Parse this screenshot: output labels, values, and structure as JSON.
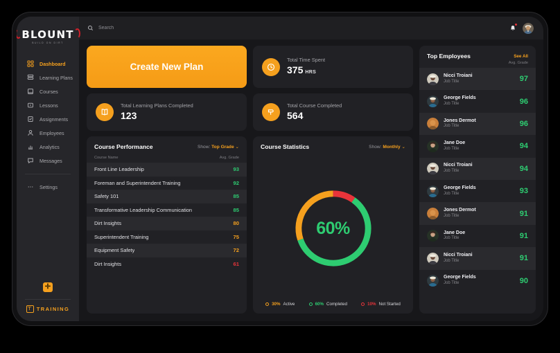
{
  "brand": {
    "logo_text": "BLOUNT",
    "logo_tagline": "BUILD ON DIRT",
    "training_label": "TRAINING",
    "accent": "#f5a01e",
    "green": "#2ecc71",
    "red": "#e8343a"
  },
  "sidebar": {
    "items": [
      {
        "label": "Dashboard",
        "icon": "grid-icon",
        "active": true
      },
      {
        "label": "Learning Plans",
        "icon": "layers-icon",
        "active": false
      },
      {
        "label": "Courses",
        "icon": "book-icon",
        "active": false
      },
      {
        "label": "Lessons",
        "icon": "play-square-icon",
        "active": false
      },
      {
        "label": "Assignments",
        "icon": "clipboard-check-icon",
        "active": false
      },
      {
        "label": "Employees",
        "icon": "user-icon",
        "active": false
      },
      {
        "label": "Analytics",
        "icon": "bar-chart-icon",
        "active": false
      },
      {
        "label": "Messages",
        "icon": "message-icon",
        "active": false
      }
    ],
    "settings": {
      "label": "Settings",
      "icon": "dots-icon"
    },
    "plus_badge": "✛"
  },
  "topbar": {
    "search_placeholder": "Search",
    "search_value": "",
    "notification_badge": true
  },
  "main": {
    "create_plan_label": "Create New Plan",
    "stats": [
      {
        "label": "Total Learning Plans Completed",
        "value": "123",
        "unit": "",
        "icon": "book-open-icon"
      },
      {
        "label": "Total Time Spent",
        "value": "375",
        "unit": "HRS",
        "icon": "clock-icon"
      },
      {
        "label": "Total Course Completed",
        "value": "564",
        "unit": "",
        "icon": "hammer-icon"
      }
    ]
  },
  "course_performance": {
    "title": "Course Performance",
    "show_label": "Show:",
    "show_value": "Top Grade",
    "col_name": "Course Name",
    "col_grade": "Avg. Grade",
    "rows": [
      {
        "name": "Front Line Leadership",
        "grade": "93",
        "color": "#2ecc71"
      },
      {
        "name": "Foreman and Superintendent Training",
        "grade": "92",
        "color": "#2ecc71"
      },
      {
        "name": "Safety 101",
        "grade": "85",
        "color": "#2ecc71"
      },
      {
        "name": "Transformative Leadership Communication",
        "grade": "85",
        "color": "#2ecc71"
      },
      {
        "name": "Dirt Insights",
        "grade": "80",
        "color": "#f5a01e"
      },
      {
        "name": "Superintendent Training",
        "grade": "75",
        "color": "#f5a01e"
      },
      {
        "name": "Equipment Safety",
        "grade": "72",
        "color": "#f5a01e"
      },
      {
        "name": "Dirt Insights",
        "grade": "61",
        "color": "#e8343a"
      }
    ]
  },
  "course_statistics": {
    "title": "Course Statistics",
    "show_label": "Show:",
    "show_value": "Monthly",
    "center_value": "60%"
  },
  "chart_data": {
    "type": "pie",
    "title": "Course Statistics",
    "categories": [
      "Completed",
      "Active",
      "Not Started"
    ],
    "values": [
      60,
      30,
      10
    ],
    "colors": [
      "#2ecc71",
      "#f5a01e",
      "#e8343a"
    ],
    "labels": [
      "60% Completed",
      "30% Active",
      "10% Not Started"
    ],
    "legend": [
      {
        "text_pc": "30%",
        "text": "Active",
        "color": "#f5a01e"
      },
      {
        "text_pc": "60%",
        "text": "Completed",
        "color": "#2ecc71"
      },
      {
        "text_pc": "10%",
        "text": "Not Started",
        "color": "#e8343a"
      }
    ],
    "center_label": "60%",
    "legend_position": "bottom",
    "grid": false
  },
  "top_employees": {
    "title": "Top Employees",
    "see_all": "See All",
    "col_grade": "Avg. Grade",
    "rows": [
      {
        "name": "Nicci Troiani",
        "job": "Job Title",
        "grade": "97"
      },
      {
        "name": "George Fields",
        "job": "Job Title",
        "grade": "96"
      },
      {
        "name": "Jones Dermot",
        "job": "Job Title",
        "grade": "96"
      },
      {
        "name": "Jane Doe",
        "job": "Job Title",
        "grade": "94"
      },
      {
        "name": "Nicci Troiani",
        "job": "Job Title",
        "grade": "94"
      },
      {
        "name": "George Fields",
        "job": "Job Title",
        "grade": "93"
      },
      {
        "name": "Jones Dermot",
        "job": "Job Title",
        "grade": "91"
      },
      {
        "name": "Jane Doe",
        "job": "Job Title",
        "grade": "91"
      },
      {
        "name": "Nicci Troiani",
        "job": "Job Title",
        "grade": "91"
      },
      {
        "name": "George Fields",
        "job": "Job Title",
        "grade": "90"
      }
    ]
  }
}
